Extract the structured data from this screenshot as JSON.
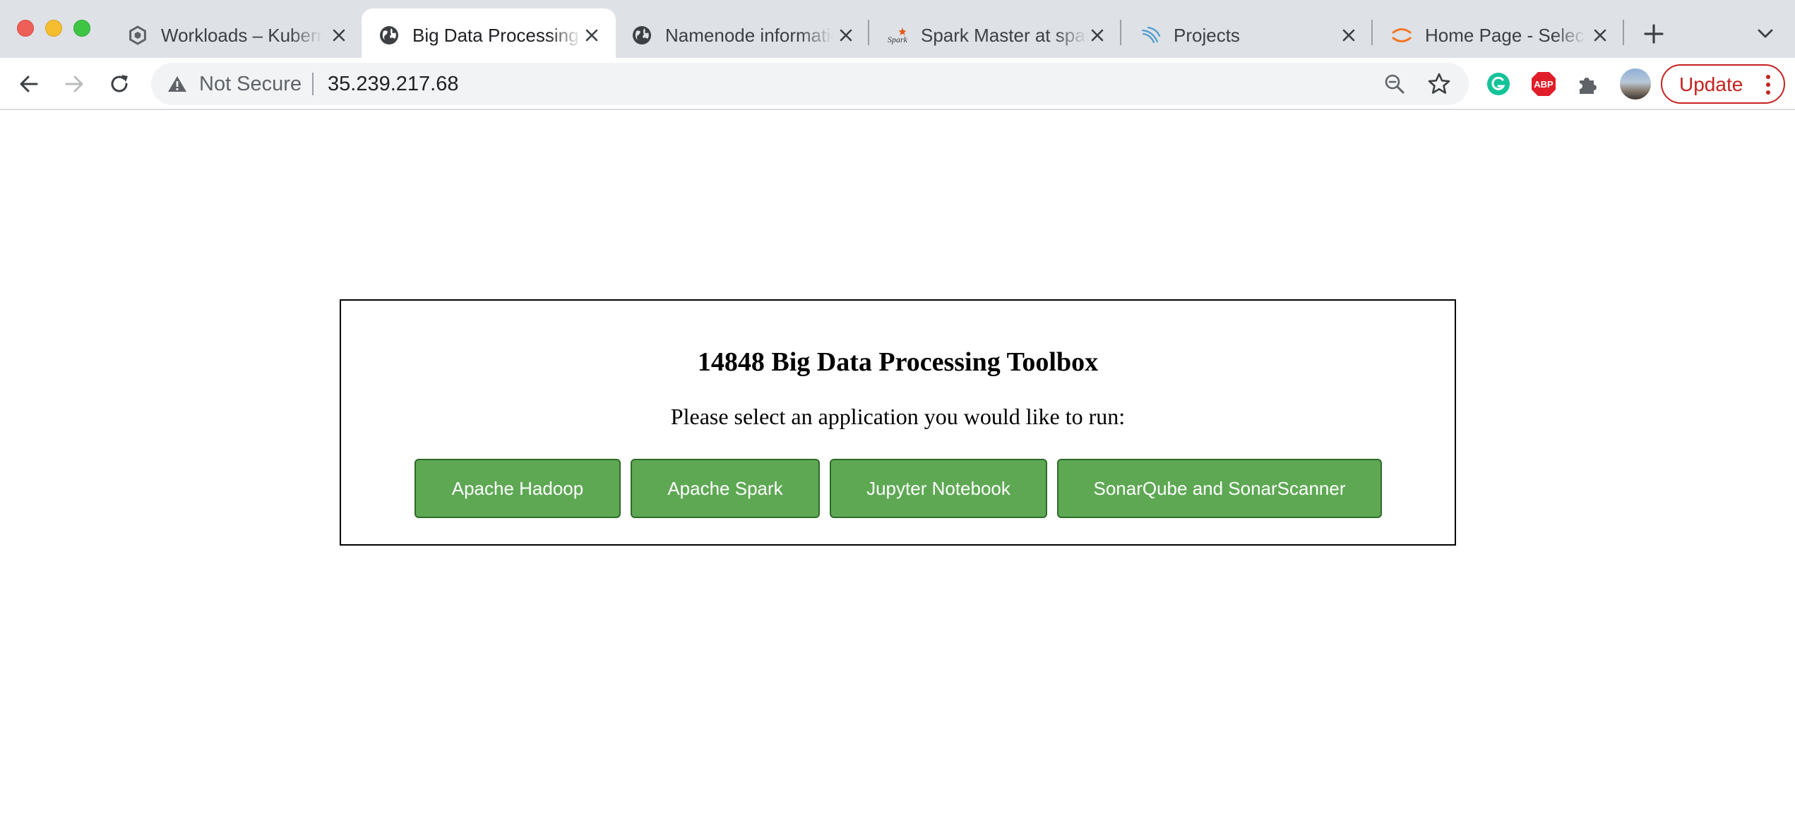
{
  "browser": {
    "tabs": [
      {
        "title": "Workloads – Kubernetes",
        "icon": "kubernetes-engine-icon"
      },
      {
        "title": "Big Data Processing Toolbox",
        "icon": "globe-icon",
        "active": true
      },
      {
        "title": "Namenode information",
        "icon": "globe-icon"
      },
      {
        "title": "Spark Master at spark",
        "icon": "spark-logo-icon"
      },
      {
        "title": "Projects",
        "icon": "sonarqube-logo-icon"
      },
      {
        "title": "Home Page - Select",
        "icon": "jupyter-logo-icon"
      }
    ],
    "address_bar": {
      "security_label": "Not Secure",
      "url": "35.239.217.68"
    },
    "extensions": [
      {
        "name": "grammarly-extension-icon",
        "color": "#15c39a"
      },
      {
        "name": "adblock-plus-extension-icon",
        "label": "ABP",
        "color": "#e01e2a"
      },
      {
        "name": "extensions-puzzle-icon",
        "color": "#5f6368"
      }
    ],
    "update_button": {
      "label": "Update",
      "color": "#c5221f"
    }
  },
  "page": {
    "heading": "14848 Big Data Processing Toolbox",
    "prompt": "Please select an application you would like to run:",
    "buttons": [
      {
        "label": "Apache Hadoop"
      },
      {
        "label": "Apache Spark"
      },
      {
        "label": "Jupyter Notebook"
      },
      {
        "label": "SonarQube and SonarScanner"
      }
    ],
    "button_color": "#5ea854"
  }
}
